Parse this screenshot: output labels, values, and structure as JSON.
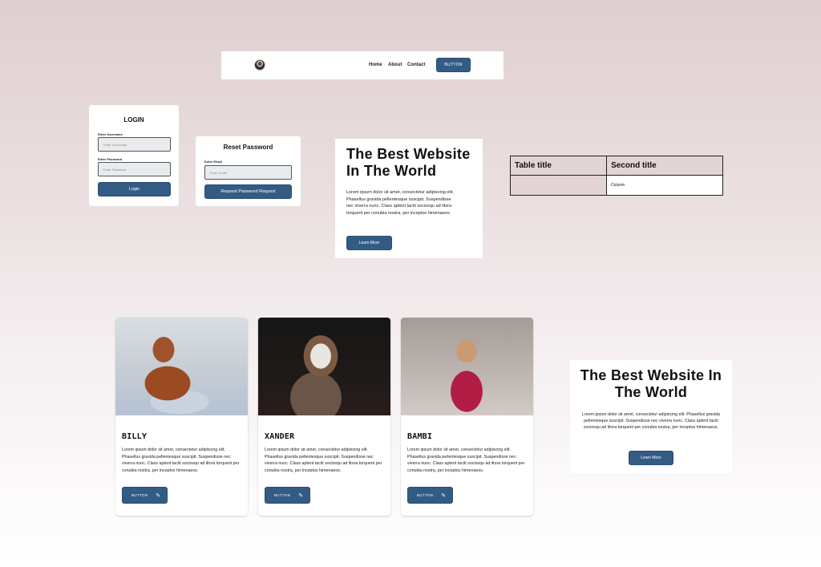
{
  "navbar": {
    "links": [
      "Home",
      "About",
      "Contact"
    ],
    "button_label": "BUTTON"
  },
  "login": {
    "title": "LOGIN",
    "username_label": "Enter Username",
    "username_placeholder": "Enter Username",
    "password_label": "Enter Password",
    "password_placeholder": "Enter Password",
    "button_label": "Login"
  },
  "reset": {
    "title": "Reset Password",
    "email_label": "Enter Email",
    "email_placeholder": "Enter Email",
    "button_label": "Request Password Request"
  },
  "hero1": {
    "title": "The Best Website In The World",
    "body": "Lorem ipsum dolor sit amet, consectetur adipiscing elit. Phasellus gravida pellentesque suscipit. Suspendisse nec viverra nunc. Class aptent taciti sociosqu ad litora torquent per conubia nostra, per inceptos himenaeos.",
    "button_label": "Learn More"
  },
  "table": {
    "headers": [
      "Table title",
      "Second title"
    ],
    "rows": [
      [
        "",
        "Column"
      ]
    ]
  },
  "cards": [
    {
      "name": "BILLY",
      "desc": "Lorem ipsum dolor sit amet, consectetur adipiscing elit. Phasellus gravida pellentesque suscipit. Suspendisse nec viverra nunc. Class aptent taciti sociosqu ad litora torquent per conubia nostra, per inceptos himenaeos.",
      "button_label": "BUTTON",
      "button_icon": "pen-nib-icon"
    },
    {
      "name": "XANDER",
      "desc": "Lorem ipsum dolor sit amet, consectetur adipiscing elit. Phasellus gravida pellentesque suscipit. Suspendisse nec viverra nunc. Class aptent taciti sociosqu ad litora torquent per conubia nostra, per inceptos himenaeos.",
      "button_label": "BUTTON",
      "button_icon": "pen-nib-icon"
    },
    {
      "name": "BAMBI",
      "desc": "Lorem ipsum dolor sit amet, consectetur adipiscing elit. Phasellus gravida pellentesque suscipit. Suspendisse nec viverra nunc. Class aptent taciti sociosqu ad litora torquent per conubia nostra, per inceptos himenaeos.",
      "button_label": "BUTTON",
      "button_icon": "pen-nib-icon"
    }
  ],
  "hero2": {
    "title": "The Best Website In The World",
    "body": "Lorem ipsum dolor sit amet, consectetur adipiscing elit. Phasellus gravida pellentesque suscipit. Suspendisse nec viverra nunc. Class aptent taciti sociosqu ad litora torquent per conubia nostra, per inceptos himenaeos.",
    "button_label": "Learn More"
  },
  "colors": {
    "accent": "#335c85",
    "table_header_bg": "#e3d4d5",
    "background_top": "#e0cfd0",
    "background_bottom": "#ffffff"
  }
}
